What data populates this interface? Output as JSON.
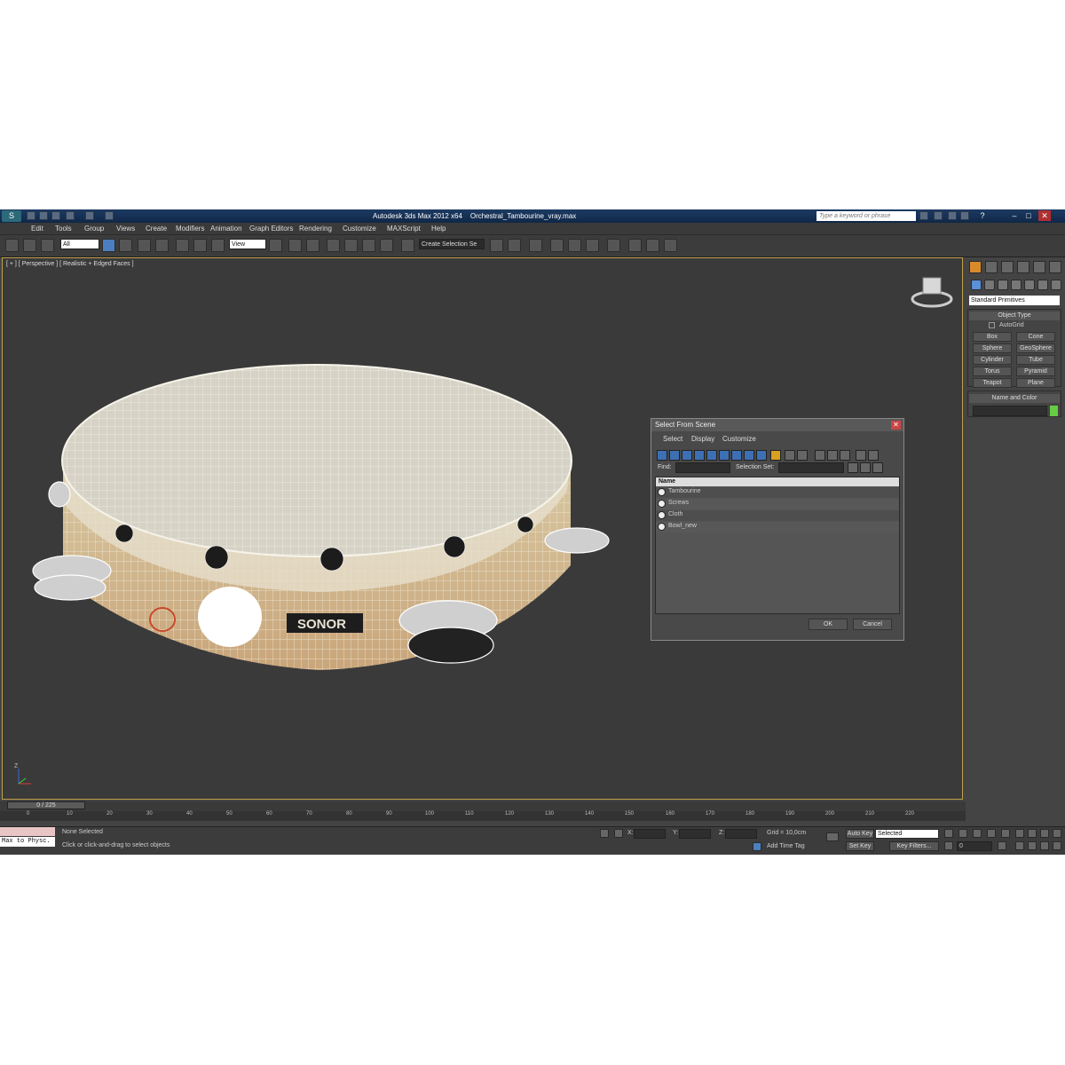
{
  "window": {
    "app_title": "Autodesk 3ds Max  2012 x64",
    "file_name": "Orchestral_Tambourine_vray.max",
    "search_placeholder": "Type a keyword or phrase",
    "help_glyph": "?",
    "minimize_glyph": "–",
    "maximize_glyph": "□",
    "close_glyph": "✕"
  },
  "menu": [
    "Edit",
    "Tools",
    "Group",
    "Views",
    "Create",
    "Modifiers",
    "Animation",
    "Graph Editors",
    "Rendering",
    "Customize",
    "MAXScript",
    "Help"
  ],
  "toolbar": {
    "filter_value": "All",
    "coord_value": "View",
    "selection_set_placeholder": "Create Selection Se"
  },
  "viewport": {
    "label": "[ + ] [ Perspective ] [ Realistic + Edged Faces ]",
    "logo_text": "SONOR",
    "axis_label": "Z"
  },
  "command_panel": {
    "category": "Standard Primitives",
    "object_type_title": "Object Type",
    "autogrid_label": "AutoGrid",
    "primitives": [
      "Box",
      "Cone",
      "Sphere",
      "GeoSphere",
      "Cylinder",
      "Tube",
      "Torus",
      "Pyramid",
      "Teapot",
      "Plane"
    ],
    "name_color_title": "Name and Color",
    "object_color": "#66cc44"
  },
  "dialog": {
    "title": "Select From Scene",
    "close_glyph": "✕",
    "menus": [
      "Select",
      "Display",
      "Customize"
    ],
    "find_label": "Find:",
    "selection_set_label": "Selection Set:",
    "column_header": "Name",
    "items": [
      "Tambourine",
      "Screws",
      "Cloth",
      "Bowl_new"
    ],
    "ok_label": "OK",
    "cancel_label": "Cancel"
  },
  "timeline": {
    "frame_label": "0 / 225",
    "ticks": [
      "0",
      "10",
      "20",
      "30",
      "40",
      "50",
      "60",
      "70",
      "80",
      "90",
      "100",
      "110",
      "120",
      "130",
      "140",
      "150",
      "160",
      "170",
      "180",
      "190",
      "200",
      "210",
      "220"
    ]
  },
  "status": {
    "script_label": "Max to Physc.",
    "selection_status": "None Selected",
    "prompt": "Click or click-and-drag to select objects",
    "x_label": "X:",
    "y_label": "Y:",
    "z_label": "Z:",
    "grid": "Grid = 10,0cm",
    "add_time_tag": "Add Time Tag",
    "auto_key": "Auto Key",
    "key_mode": "Selected",
    "set_key": "Set Key",
    "key_filters": "Key Filters...",
    "frame_value": "0"
  }
}
